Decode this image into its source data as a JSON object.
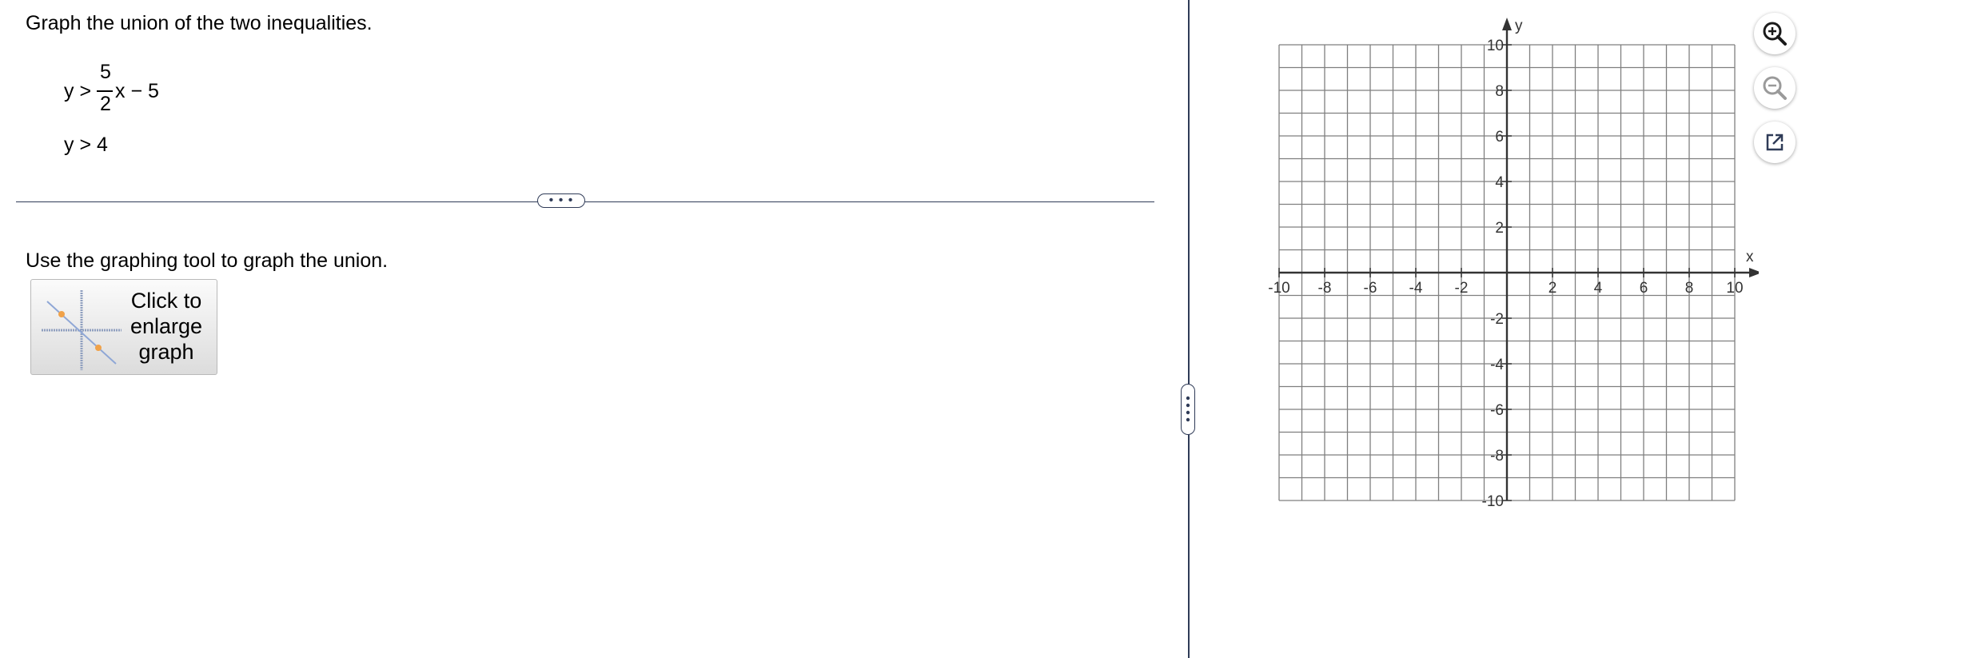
{
  "question": {
    "prompt": "Graph the union of the two inequalities.",
    "ineq1": {
      "lhs": "y >",
      "numerator": "5",
      "denominator": "2",
      "rhs": "x − 5"
    },
    "ineq2": "y > 4"
  },
  "divider_handle": "• • •",
  "instruction": "Use the graphing tool to graph the union.",
  "enlarge_button": {
    "line1": "Click to",
    "line2": "enlarge",
    "line3": "graph"
  },
  "graph": {
    "x_label": "x",
    "y_label": "y",
    "xlim": [
      -10,
      10
    ],
    "ylim": [
      -10,
      10
    ],
    "grid_step": 1,
    "x_tick_labels": [
      "-10",
      "-8",
      "-6",
      "-4",
      "-2",
      "2",
      "4",
      "6",
      "8",
      "10"
    ],
    "y_tick_labels": [
      "10",
      "8",
      "6",
      "4",
      "2",
      "-2",
      "-4",
      "-6",
      "-8",
      "-10"
    ]
  },
  "tools": {
    "zoom_in": "zoom-in-icon",
    "zoom_out": "zoom-out-icon",
    "popout": "popout-icon"
  },
  "colors": {
    "divider": "#2f3b57",
    "grid": "#7f7f7f",
    "axis": "#333333",
    "tool_accent": "#1a1a1a"
  }
}
